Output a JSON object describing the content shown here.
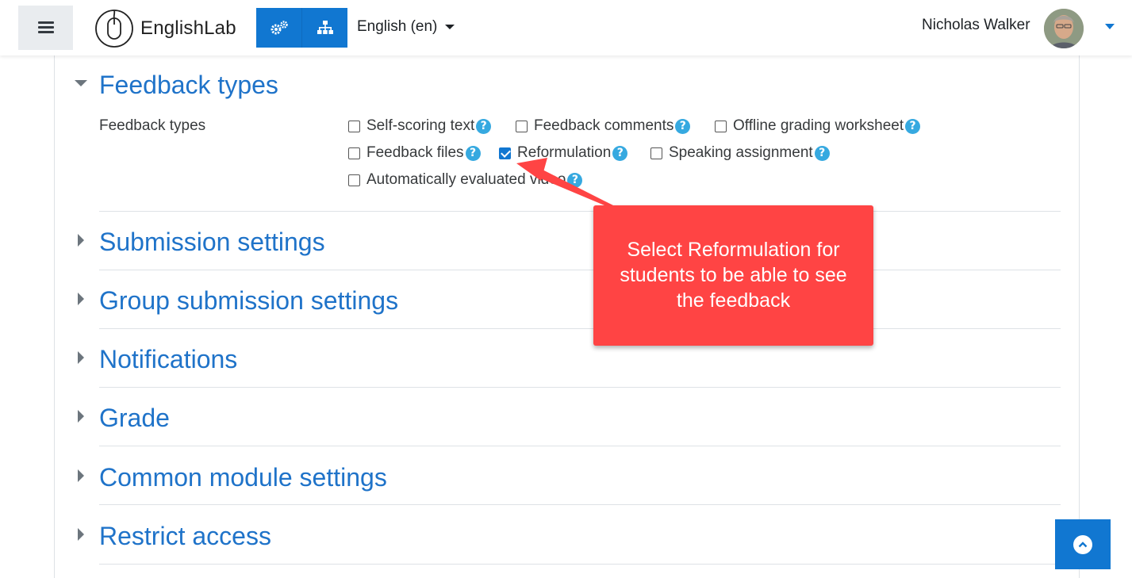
{
  "navbar": {
    "brand": "EnglishLab",
    "language": "English (en)",
    "user_name": "Nicholas Walker",
    "icons": [
      "menu-icon",
      "mouse-logo-icon",
      "cogs-icon",
      "sitemap-icon",
      "avatar",
      "chevron-down-icon"
    ]
  },
  "feedback": {
    "section_title": "Feedback types",
    "field_label": "Feedback types",
    "options": [
      {
        "label": "Self-scoring text",
        "checked": false
      },
      {
        "label": "Feedback comments",
        "checked": false
      },
      {
        "label": "Offline grading worksheet",
        "checked": false
      },
      {
        "label": "Feedback files",
        "checked": false
      },
      {
        "label": "Reformulation",
        "checked": true
      },
      {
        "label": "Speaking assignment",
        "checked": false
      },
      {
        "label": "Automatically evaluated video",
        "checked": false
      }
    ]
  },
  "sections": [
    "Submission settings",
    "Group submission settings",
    "Notifications",
    "Grade",
    "Common module settings",
    "Restrict access"
  ],
  "callout": {
    "line1": "Select Reformulation for",
    "line2": "students to be able to see",
    "line3": "the feedback"
  },
  "colors": {
    "accent": "#1177d1",
    "link": "#1f73c9",
    "callout": "#ff4444",
    "help": "#36a9e0"
  }
}
